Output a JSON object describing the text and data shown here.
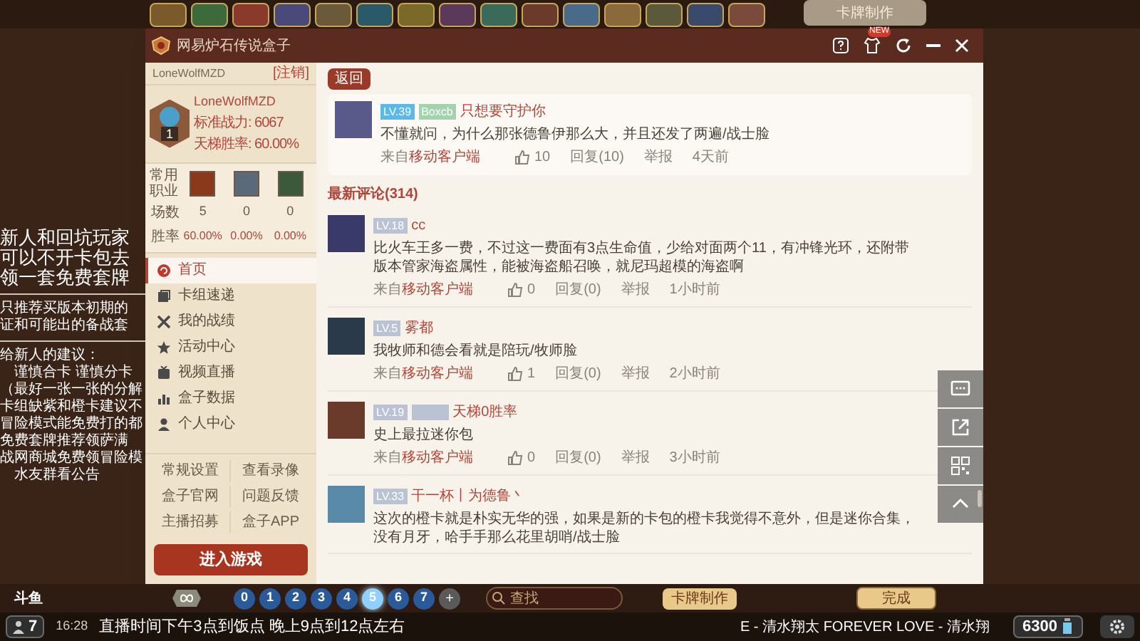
{
  "game": {
    "top_button": "卡牌制作",
    "mana_filters": [
      {
        "label": "0",
        "selected": false
      },
      {
        "label": "1",
        "selected": false
      },
      {
        "label": "2",
        "selected": false
      },
      {
        "label": "3",
        "selected": false
      },
      {
        "label": "4",
        "selected": false
      },
      {
        "label": "5",
        "selected": true
      },
      {
        "label": "6",
        "selected": false
      },
      {
        "label": "7",
        "selected": false
      }
    ],
    "mana_more": "+",
    "search": {
      "placeholder": "查找"
    },
    "craft_button": "卡牌制作",
    "done_button": "完成"
  },
  "overlay_notes": [
    [
      "新人和回坑玩家",
      "可以不开卡包去",
      "领一套免费套牌"
    ],
    [
      "只推荐买版本初期的",
      "证和可能出的备战套"
    ],
    [
      "给新人的建议：",
      "谨慎合卡 谨慎分卡",
      "（最好一张一张的分解",
      "卡组缺紫和橙卡建议不",
      "冒险模式能免费打的都",
      "免费套牌推荐领萨满",
      "战网商城免费领冒险模",
      "水友群看公告"
    ]
  ],
  "window": {
    "title": "网易炉石传说盒子",
    "new_badge": "NEW"
  },
  "sidebar": {
    "account": "LoneWolfMZD",
    "logout": "[注销]",
    "profile": {
      "rank": "1",
      "name": "LoneWolfMZD",
      "power": "标准战力: 6067",
      "winrate": "天梯胜率: 60.00%"
    },
    "stats": {
      "class_label": "常用职业",
      "games_label": "场数",
      "winrate_label": "胜率",
      "games": [
        "5",
        "0",
        "0"
      ],
      "winrates": [
        "60.00%",
        "0.00%",
        "0.00%"
      ]
    },
    "nav": [
      {
        "label": "首页",
        "selected": true
      },
      {
        "label": "卡组速递",
        "selected": false
      },
      {
        "label": "我的战绩",
        "selected": false
      },
      {
        "label": "活动中心",
        "selected": false
      },
      {
        "label": "视频直播",
        "selected": false
      },
      {
        "label": "盒子数据",
        "selected": false
      },
      {
        "label": "个人中心",
        "selected": false
      }
    ],
    "links": [
      "常规设置",
      "查看录像",
      "盒子官网",
      "问题反馈",
      "主播招募",
      "盒子APP"
    ],
    "play_button": "进入游戏"
  },
  "main": {
    "back_button": "返回",
    "post": {
      "level": {
        "label": "LV.39",
        "color": "#5bb8e8"
      },
      "tag": {
        "label": "Boxcb",
        "color": "#a3d3ae"
      },
      "name": "只想要守护你",
      "text": "不懂就问，为什么那张德鲁伊那么大，并且还发了两遍/战士脸",
      "source_prefix": "来自",
      "source": "移动客户端",
      "likes": "10",
      "reply": "回复(10)",
      "report": "举报",
      "time": "4天前"
    },
    "comments_heading": "最新评论(314)",
    "comments": [
      {
        "level": {
          "label": "LV.18",
          "color": "#b9c3d3"
        },
        "name": "cc",
        "text": "比火车王多一费，不过这一费面有3点生命值，少给对面两个11，有冲锋光环，还附带版本管家海盗属性，能被海盗船召唤，就尼玛超模的海盗啊",
        "footer": {
          "source_prefix": "来自",
          "source": "移动客户端",
          "likes": "0",
          "reply": "回复(0)",
          "report": "举报",
          "time": "1小时前"
        }
      },
      {
        "level": {
          "label": "LV.5",
          "color": "#b9c3d3"
        },
        "name": "雾都",
        "text": "我牧师和德会看就是陪玩/牧师脸",
        "footer": {
          "source_prefix": "来自",
          "source": "移动客户端",
          "likes": "1",
          "reply": "回复(0)",
          "report": "举报",
          "time": "2小时前"
        }
      },
      {
        "level": {
          "label": "LV.19",
          "color": "#b9c3d3"
        },
        "tag": {
          "color": "#b9c3d3"
        },
        "name": "天梯0胜率",
        "text": "史上最拉迷你包",
        "footer": {
          "source_prefix": "来自",
          "source": "移动客户端",
          "likes": "0",
          "reply": "回复(0)",
          "report": "举报",
          "time": "3小时前"
        }
      },
      {
        "level": {
          "label": "LV.33",
          "color": "#b9c3d3"
        },
        "name": "干一杯丨为德鲁丶",
        "text": "这次的橙卡就是朴实无华的强，如果是新的卡包的橙卡我觉得不意外，但是迷你合集，没有月牙，哈手手那么花里胡哨/战士脸"
      }
    ]
  },
  "stream_bar": {
    "logo": "斗鱼",
    "viewers": "7",
    "time": "16:28",
    "notice": "直播时间下午3点到饭点 晚上9点到12点左右",
    "music": "E - 清水翔太 FOREVER LOVE - 清水翔",
    "dust": "6300"
  }
}
